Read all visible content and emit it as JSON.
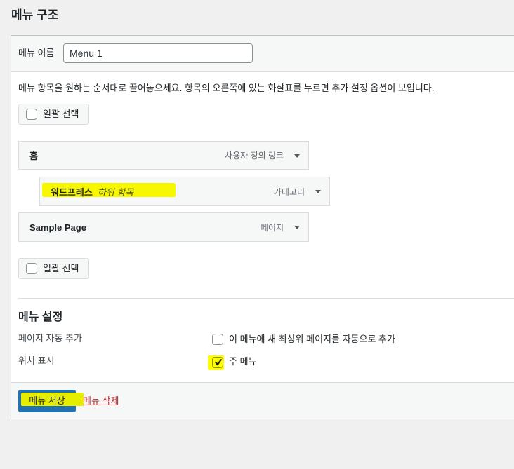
{
  "page": {
    "title": "메뉴 구조"
  },
  "menu_name": {
    "label": "메뉴 이름",
    "value": "Menu 1"
  },
  "instructions": "메뉴 항목을 원하는 순서대로 끌어놓으세요. 항목의 오른쪽에 있는 화살표를 누르면 추가 설정 옵션이 보입니다.",
  "bulk_select": {
    "label": "일괄 선택",
    "checked": false
  },
  "menu_items": [
    {
      "title": "홈",
      "type": "사용자 정의 링크",
      "depth": 0
    },
    {
      "title": "워드프레스",
      "subtitle": "하위 항목",
      "type": "카테고리",
      "depth": 1
    },
    {
      "title": "Sample Page",
      "type": "페이지",
      "depth": 0
    }
  ],
  "settings": {
    "heading": "메뉴 설정",
    "auto_add": {
      "label": "페이지 자동 추가",
      "option": "이 메뉴에 새 최상위 페이지를 자동으로 추가",
      "checked": false
    },
    "locations": {
      "label": "위치 표시",
      "option": "주 메뉴",
      "checked": true
    }
  },
  "actions": {
    "save": "메뉴 저장",
    "delete": "메뉴 삭제"
  },
  "icons": {
    "expand": "arrow-down-icon",
    "checked": "checkmark-icon"
  },
  "colors": {
    "background": "#f0f0f1",
    "panel": "#ffffff",
    "bar": "#f6f7f7",
    "primary_button": "#2271b1",
    "delete_link": "#b32d2e",
    "text": "#1d2327",
    "muted_text": "#646970",
    "highlight": "#ffff00"
  }
}
